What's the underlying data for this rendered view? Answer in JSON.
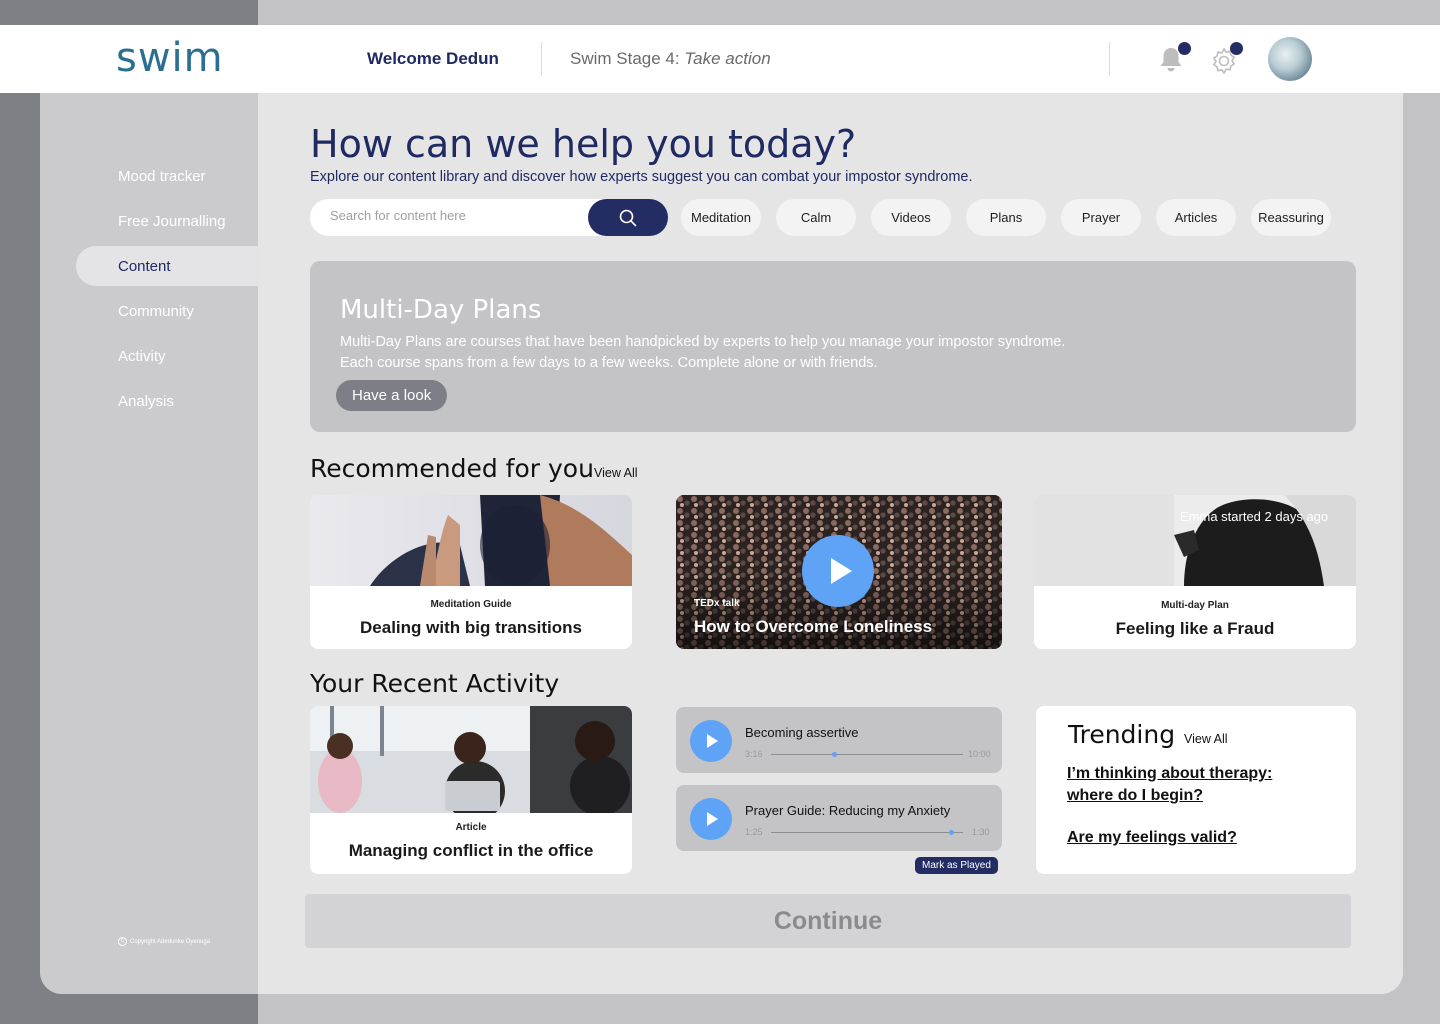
{
  "header": {
    "logo": "swim",
    "welcome": "Welcome Dedun",
    "stage_prefix": "Swim Stage 4: ",
    "stage_emphasis": "Take action"
  },
  "sidebar": {
    "items": [
      {
        "label": "Mood tracker"
      },
      {
        "label": "Free Journalling"
      },
      {
        "label": "Content"
      },
      {
        "label": "Community"
      },
      {
        "label": "Activity"
      },
      {
        "label": "Analysis"
      }
    ],
    "active": "Content",
    "copyright": "Copyright Adedunke Oyenuga"
  },
  "hero": {
    "title": "How can we help you today?",
    "subtitle": "Explore our content library and discover how experts suggest you can combat your impostor syndrome."
  },
  "search": {
    "placeholder": "Search for content here"
  },
  "chips": [
    "Meditation",
    "Calm",
    "Videos",
    "Plans",
    "Prayer",
    "Articles",
    "Reassuring"
  ],
  "banner": {
    "title": "Multi-Day Plans",
    "line1": "Multi-Day Plans are courses that have been handpicked by experts to help you manage your impostor syndrome.",
    "line2": "Each course spans from a few days to a few weeks. Complete alone or with friends.",
    "button": "Have a look"
  },
  "recommended": {
    "title": "Recommended for you",
    "view_all": "View All",
    "cards": [
      {
        "tag": "Meditation Guide",
        "title": "Dealing with big transitions"
      },
      {
        "tag": "TEDx talk",
        "title": "How to Overcome Loneliness"
      },
      {
        "tag": "Multi-day Plan",
        "title": "Feeling like a Fraud",
        "overlay": "Emma started 2 days ago"
      }
    ]
  },
  "recent": {
    "title": "Your Recent Activity",
    "article": {
      "tag": "Article",
      "title": "Managing conflict in the office"
    },
    "players": [
      {
        "title": "Becoming assertive",
        "elapsed": "3:16",
        "duration": "10:00",
        "progress": 0.33
      },
      {
        "title": "Prayer Guide: Reducing my Anxiety",
        "elapsed": "1:25",
        "duration": "1:30",
        "progress": 0.94
      }
    ],
    "mark_played": "Mark as Played"
  },
  "trending": {
    "title": "Trending",
    "view_all": "View All",
    "links": [
      "I’m thinking about therapy: where do I begin?",
      "Are my feelings valid?"
    ]
  },
  "continue": "Continue",
  "colors": {
    "primary": "#232d63",
    "accent": "#5ea3f5",
    "logo": "#2a6e90"
  }
}
